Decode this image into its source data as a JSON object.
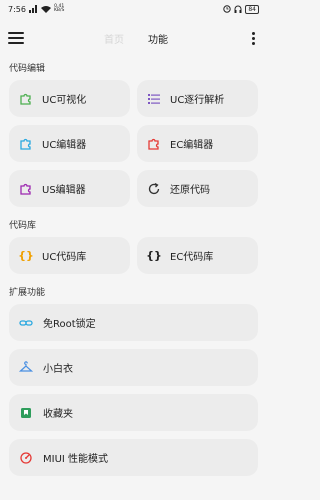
{
  "status": {
    "time": "7:56",
    "speed_top": "0.41",
    "speed_unit": "KB/S",
    "battery": "84"
  },
  "topbar": {
    "tab_home": "首页",
    "tab_func": "功能"
  },
  "sections": {
    "code_edit": {
      "title": "代码编辑",
      "items": [
        {
          "label": "UC可视化",
          "icon": "puzzle-icon",
          "color": "#4caf50"
        },
        {
          "label": "UC逐行解析",
          "icon": "list-icon",
          "color": "#7e57c2"
        },
        {
          "label": "UC编辑器",
          "icon": "puzzle-icon",
          "color": "#29a8e0"
        },
        {
          "label": "EC编辑器",
          "icon": "puzzle-icon",
          "color": "#e53935"
        },
        {
          "label": "US编辑器",
          "icon": "puzzle-icon",
          "color": "#9c27b0"
        },
        {
          "label": "还原代码",
          "icon": "refresh-icon",
          "color": "#333333"
        }
      ]
    },
    "code_lib": {
      "title": "代码库",
      "items": [
        {
          "label": "UC代码库",
          "icon": "braces-icon",
          "color": "#f0a000"
        },
        {
          "label": "EC代码库",
          "icon": "braces-icon",
          "color": "#222222"
        }
      ]
    },
    "ext": {
      "title": "扩展功能",
      "items": [
        {
          "label": "免Root锁定",
          "icon": "link-icon",
          "color": "#29a8e0"
        },
        {
          "label": "小白衣",
          "icon": "hanger-icon",
          "color": "#4a90e2"
        },
        {
          "label": "收藏夹",
          "icon": "bookmark-icon",
          "color": "#2e9d5b"
        },
        {
          "label": "MIUI 性能模式",
          "icon": "gauge-icon",
          "color": "#e53935"
        }
      ]
    }
  }
}
